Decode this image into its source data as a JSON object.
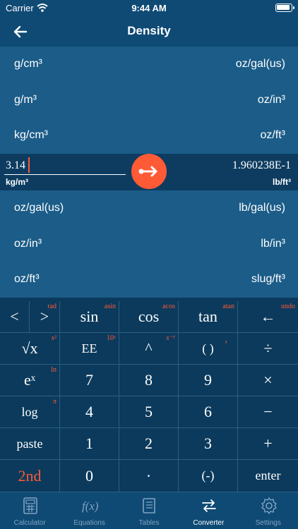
{
  "status": {
    "carrier": "Carrier",
    "time": "9:44 AM"
  },
  "header": {
    "title": "Density"
  },
  "from_list": [
    {
      "left": "g/cm³",
      "right": "oz/gal(us)"
    },
    {
      "left": "g/m³",
      "right": "oz/in³"
    },
    {
      "left": "kg/cm³",
      "right": "oz/ft³"
    }
  ],
  "conversion": {
    "input_value": "3.14",
    "from_unit": "kg/m³",
    "result_value": "1.960238E-1",
    "to_unit": "lb/ft³"
  },
  "to_list": [
    {
      "left": "oz/gal(us)",
      "right": "lb/gal(us)"
    },
    {
      "left": "oz/in³",
      "right": "lb/in³"
    },
    {
      "left": "oz/ft³",
      "right": "slug/ft³"
    }
  ],
  "keypad": {
    "row1": {
      "left": "<",
      "right": ">",
      "rad": "rad",
      "sin": "sin",
      "asin": "asin",
      "cos": "cos",
      "acos": "acos",
      "tan": "tan",
      "atan": "atan",
      "back": "←",
      "undo": "undo"
    },
    "row2": {
      "sqrt": "√x",
      "x2": "x²",
      "ee": "EE",
      "tenx": "10ˣ",
      "caret": "^",
      "xinv": "x⁻¹",
      "paren": "( )",
      "comma": ",",
      "divide": "÷"
    },
    "row3": {
      "ex": "eˣ",
      "ln": "ln",
      "seven": "7",
      "eight": "8",
      "nine": "9",
      "multiply": "×"
    },
    "row4": {
      "log": "log",
      "pi": "π",
      "four": "4",
      "five": "5",
      "six": "6",
      "minus": "−"
    },
    "row5": {
      "paste": "paste",
      "one": "1",
      "two": "2",
      "three": "3",
      "plus": "+"
    },
    "row6": {
      "second": "2nd",
      "zero": "0",
      "dot": "·",
      "neg": "(-)",
      "enter": "enter"
    }
  },
  "tabs": [
    {
      "label": "Calculator",
      "icon": "calculator-icon"
    },
    {
      "label": "Equations",
      "icon": "function-icon"
    },
    {
      "label": "Tables",
      "icon": "book-icon"
    },
    {
      "label": "Converter",
      "icon": "swap-arrows-icon"
    },
    {
      "label": "Settings",
      "icon": "gear-icon"
    }
  ],
  "colors": {
    "accent": "#ff5a36",
    "nav": "#0f4a75",
    "list": "#1b5c88",
    "keypad": "#0b3a5c"
  }
}
